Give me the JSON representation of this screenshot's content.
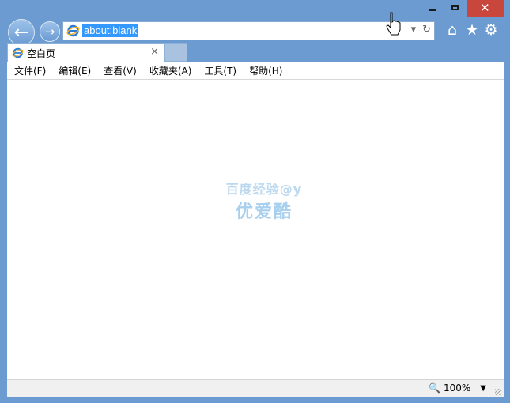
{
  "browser": {
    "address_url": "about:blank",
    "tab_title": "空白页",
    "tab_close_glyph": "×",
    "toolbar_icons": [
      "home-icon",
      "favorites-star-icon",
      "settings-gear-icon"
    ],
    "nav_icons": [
      "back-arrow-icon",
      "forward-arrow-icon"
    ],
    "address_controls": [
      "search-dropdown-icon",
      "refresh-icon"
    ]
  },
  "menu": {
    "items": [
      "文件(F)",
      "编辑(E)",
      "查看(V)",
      "收藏夹(A)",
      "工具(T)",
      "帮助(H)"
    ]
  },
  "watermark": {
    "line1": "百度经验@y",
    "line2": "优爱酷"
  },
  "status": {
    "zoom_level": "100%",
    "zoom_icon": "magnifier-icon"
  },
  "colors": {
    "frame": "#6b9bd0",
    "close_button": "#c9463d",
    "url_highlight": "#3399ff"
  }
}
